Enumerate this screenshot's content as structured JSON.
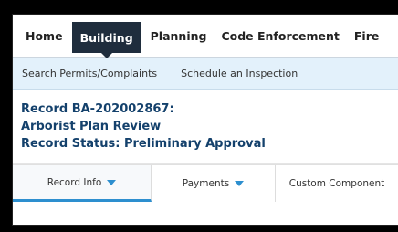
{
  "topnav": {
    "tabs": [
      {
        "label": "Home"
      },
      {
        "label": "Building"
      },
      {
        "label": "Planning"
      },
      {
        "label": "Code Enforcement"
      },
      {
        "label": "Fire"
      }
    ],
    "active": "Building"
  },
  "subnav": {
    "links": [
      {
        "label": "Search Permits/Complaints"
      },
      {
        "label": "Schedule an Inspection"
      }
    ]
  },
  "record": {
    "id_line": "Record BA-202002867:",
    "type_line": "Arborist Plan Review",
    "status_line": "Record Status: Preliminary Approval"
  },
  "record_tabs": [
    {
      "label": "Record Info",
      "icon": "caret-down-icon"
    },
    {
      "label": "Payments",
      "icon": "caret-down-icon"
    },
    {
      "label": "Custom Component"
    }
  ],
  "colors": {
    "active_tab_bg": "#1f2d3d",
    "subnav_bg": "#e3f1fb",
    "record_text": "#14416c",
    "accent": "#2d8fcf"
  }
}
